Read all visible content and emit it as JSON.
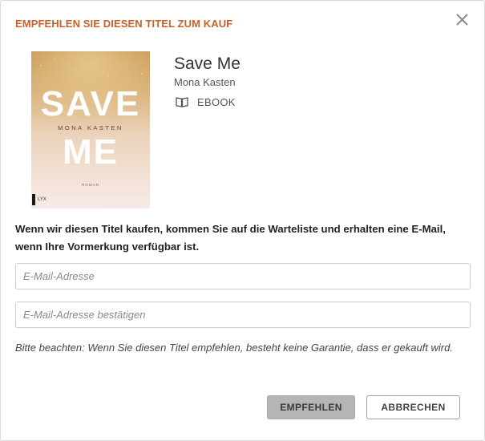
{
  "dialog": {
    "title": "EMPFEHLEN SIE DIESEN TITEL ZUM KAUF",
    "close_icon": "close-icon"
  },
  "book": {
    "title": "Save Me",
    "author": "Mona Kasten",
    "format_icon": "book-open-icon",
    "format": "EBOOK",
    "cover": {
      "line1": "SAVE",
      "line2": "ME",
      "author": "MONA KASTEN",
      "subtitle": "ROMAN",
      "publisher": "LYX"
    }
  },
  "message": {
    "info": "Wenn wir diesen Titel kaufen, kommen Sie auf die Warteliste und erhalten eine E-Mail, wenn Ihre Vormerkung verfügbar ist.",
    "note": "Bitte beachten: Wenn Sie diesen Titel empfehlen, besteht keine Garantie, dass er gekauft wird."
  },
  "form": {
    "email_placeholder": "E-Mail-Adresse",
    "email_value": "",
    "confirm_placeholder": "E-Mail-Adresse bestätigen",
    "confirm_value": ""
  },
  "actions": {
    "recommend_label": "EMPFEHLEN",
    "cancel_label": "ABBRECHEN"
  },
  "colors": {
    "title_accent": "#c8602a",
    "primary_button_bg": "#b5b5b5",
    "cover_gold": "#c9a063",
    "cover_pink": "#f6e9e6"
  }
}
